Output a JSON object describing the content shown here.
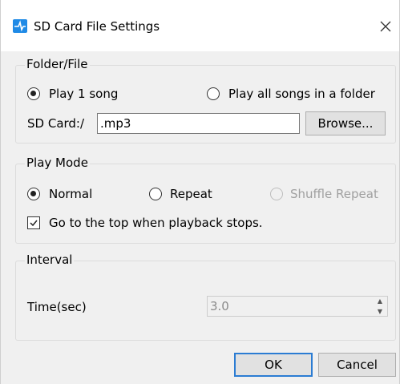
{
  "window": {
    "title": "SD Card File Settings",
    "close_symbol": "✕",
    "accent_color": "#1f8ae6"
  },
  "folder_file": {
    "group_label": "Folder/File",
    "option_play_one": "Play 1 song",
    "option_play_all": "Play all songs in a folder",
    "selected": "Play 1 song",
    "path_label": "SD Card:/",
    "path_value": ".mp3",
    "browse_label": "Browse..."
  },
  "play_mode": {
    "group_label": "Play Mode",
    "option_normal": "Normal",
    "option_repeat": "Repeat",
    "option_shuffle": "Shuffle Repeat",
    "selected": "Normal",
    "goto_top_label": "Go to the top when playback stops.",
    "goto_top_checked": true
  },
  "interval": {
    "group_label": "Interval",
    "time_label": "Time(sec)",
    "time_value": "3.0"
  },
  "footer": {
    "ok_label": "OK",
    "cancel_label": "Cancel"
  }
}
